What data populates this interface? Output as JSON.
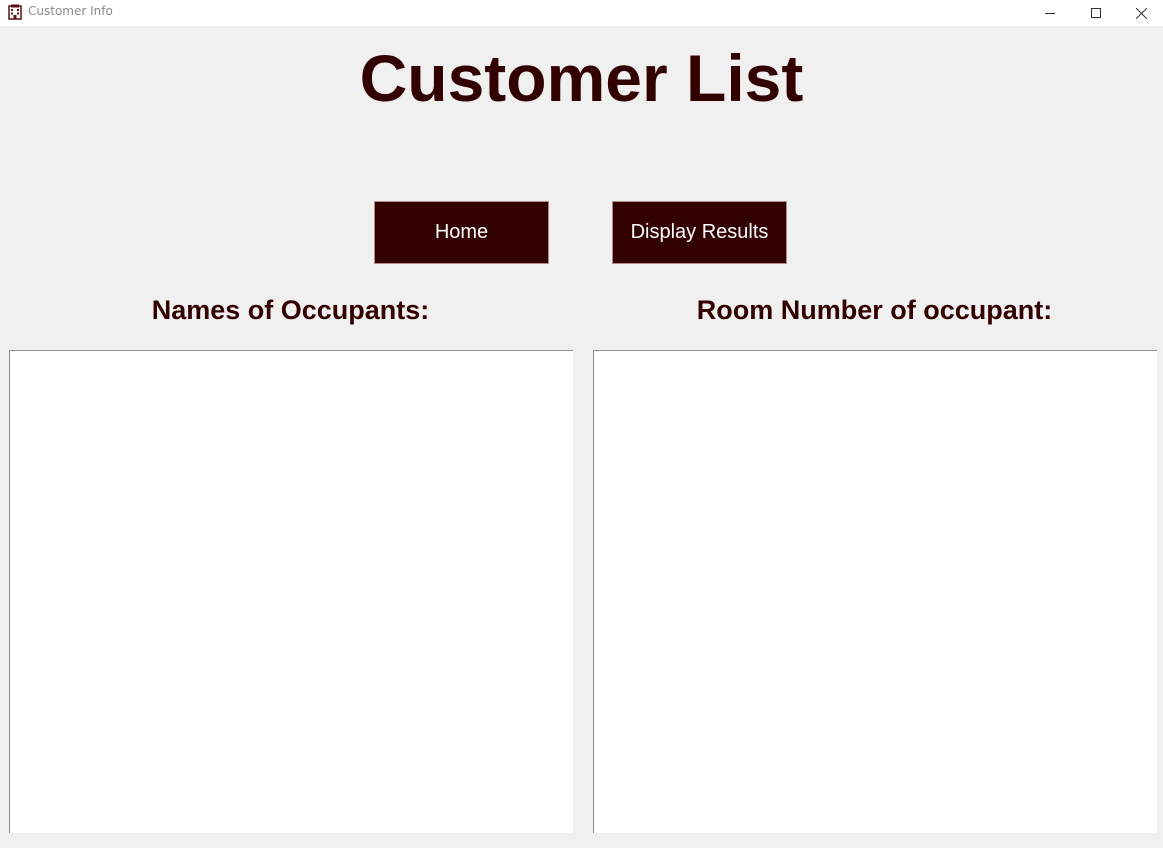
{
  "window": {
    "title": "Customer Info",
    "icon": "hotel-building-icon",
    "controls": [
      "minimize-icon",
      "maximize-icon",
      "close-icon"
    ]
  },
  "main": {
    "heading": "Customer List",
    "buttons": {
      "home_label": "Home",
      "display_label": "Display Results"
    },
    "names_label": "Names of Occupants:",
    "rooms_label": "Room Number of occupant:",
    "names_list": [],
    "rooms_list": []
  },
  "colors": {
    "accent": "#330000",
    "background": "#f0f0f0",
    "list_background": "#ffffff"
  }
}
